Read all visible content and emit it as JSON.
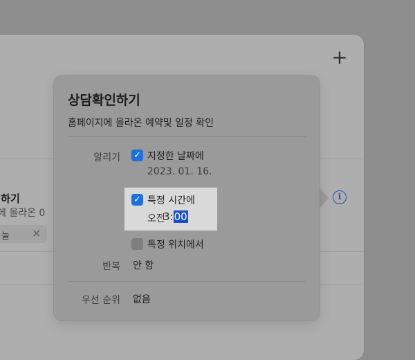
{
  "window": {
    "add_icon": "plus-icon",
    "task": {
      "title_partial": "l하기",
      "subtitle_partial": "에 올라온 0",
      "tag_label": "늘",
      "tag_remove_icon": "close-icon"
    },
    "info_icon": "info-icon"
  },
  "popover": {
    "title": "상담확인하기",
    "subtitle": "홈페이지에 올라온 예약및 일정 확인",
    "alert": {
      "label": "알리기",
      "on_date": {
        "label": "지정한 날짜에",
        "checked": true,
        "value": "2023. 01. 16."
      },
      "at_time": {
        "label": "특정 시간에",
        "checked": true,
        "period": "오전",
        "hour": "3:",
        "minute": "00"
      },
      "at_location": {
        "label": "특정 위치에서",
        "checked": false
      }
    },
    "repeat": {
      "label": "반복",
      "value": "안 함"
    },
    "priority": {
      "label": "우선 순위",
      "value": "없음"
    }
  },
  "colors": {
    "accent": "#1e6fe0",
    "info": "#1d4fc4"
  }
}
